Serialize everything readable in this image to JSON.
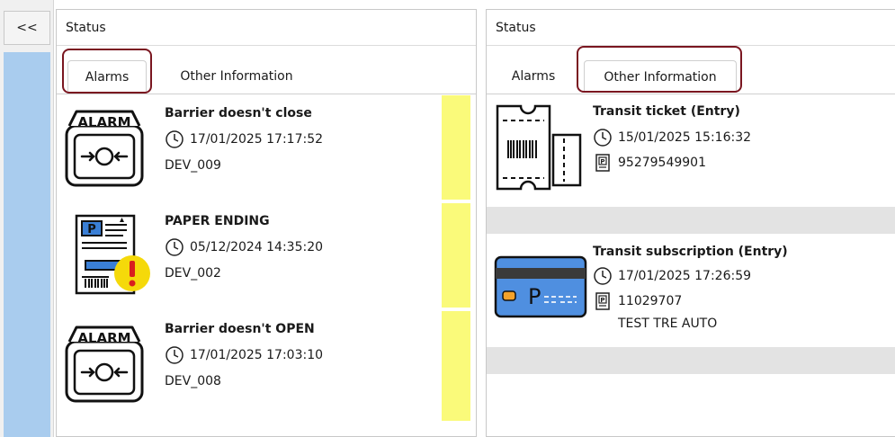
{
  "sidebar": {
    "collapse_label": "<<"
  },
  "left_panel": {
    "title": "Status",
    "tabs": [
      {
        "label": "Alarms",
        "active": true
      },
      {
        "label": "Other Information",
        "active": false
      }
    ],
    "items": [
      {
        "icon": "alarm-icon",
        "badge": "ALARM",
        "title": "Barrier doesn't close",
        "datetime": "17/01/2025 17:17:52",
        "device": "DEV_009",
        "severity_color": "#fafa7a"
      },
      {
        "icon": "paper-ending-icon",
        "title": "PAPER ENDING",
        "datetime": "05/12/2024 14:35:20",
        "device": "DEV_002",
        "severity_color": "#fafa7a"
      },
      {
        "icon": "alarm-icon",
        "badge": "ALARM",
        "title": "Barrier doesn't OPEN",
        "datetime": "17/01/2025 17:03:10",
        "device": "DEV_008",
        "severity_color": "#fafa7a"
      }
    ]
  },
  "right_panel": {
    "title": "Status",
    "tabs": [
      {
        "label": "Alarms",
        "active": false
      },
      {
        "label": "Other Information",
        "active": true
      }
    ],
    "items": [
      {
        "icon": "ticket-icon",
        "title": "Transit ticket (Entry)",
        "datetime": "15/01/2025 15:16:32",
        "code": "95279549901"
      },
      {
        "icon": "subscription-card-icon",
        "title": "Transit subscription (Entry)",
        "datetime": "17/01/2025 17:26:59",
        "code": "11029707",
        "extra": "TEST TRE AUTO"
      }
    ]
  },
  "colors": {
    "highlight": "#7a1620",
    "sidebar_blue": "#a9ccee",
    "alarm_yellow": "#fafa7a",
    "card_blue": "#4f8fe0"
  }
}
